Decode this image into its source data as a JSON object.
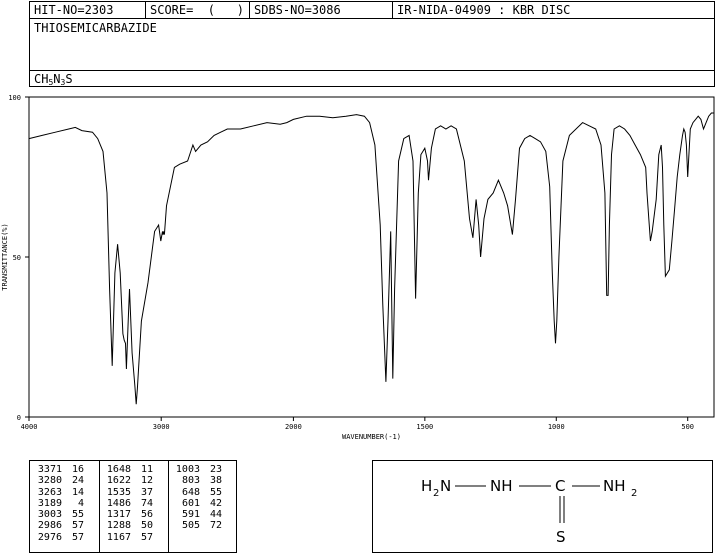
{
  "header": {
    "hit_no": "HIT-NO=2303",
    "score": "SCORE=  (   )",
    "sdbs_no": "SDBS-NO=3086",
    "ir_info": "IR-NIDA-04909 : KBR DISC",
    "compound": "THIOSEMICARBAZIDE",
    "formula": {
      "c": "CH",
      "n1": "5",
      "n": "N",
      "n2": "3",
      "s": "S"
    }
  },
  "chart_data": {
    "type": "line",
    "title": "",
    "xlabel": "WAVENUMBER(-1)",
    "ylabel": "TRANSMITTANCE(%)",
    "xlim": [
      4000,
      400
    ],
    "ylim": [
      0,
      100
    ],
    "x_ticks": [
      4000,
      3000,
      2000,
      1500,
      1000,
      500
    ],
    "x_tick_labels": [
      "4000",
      "3000",
      "2000",
      "1500",
      "1000",
      "500"
    ],
    "y_ticks": [
      0,
      50,
      100
    ],
    "y_tick_labels": [
      "0",
      "50",
      "100"
    ],
    "grid": false,
    "x": [
      4000,
      3900,
      3800,
      3700,
      3650,
      3600,
      3520,
      3480,
      3440,
      3410,
      3390,
      3371,
      3350,
      3330,
      3310,
      3290,
      3280,
      3270,
      3263,
      3250,
      3240,
      3220,
      3200,
      3189,
      3180,
      3150,
      3100,
      3050,
      3020,
      3003,
      2990,
      2986,
      2980,
      2976,
      2960,
      2900,
      2860,
      2800,
      2760,
      2740,
      2700,
      2650,
      2600,
      2550,
      2500,
      2400,
      2300,
      2200,
      2100,
      2050,
      2000,
      1950,
      1900,
      1850,
      1800,
      1760,
      1730,
      1710,
      1690,
      1670,
      1660,
      1648,
      1640,
      1630,
      1622,
      1615,
      1600,
      1580,
      1560,
      1545,
      1535,
      1525,
      1515,
      1500,
      1490,
      1486,
      1475,
      1460,
      1440,
      1420,
      1400,
      1380,
      1350,
      1330,
      1317,
      1305,
      1295,
      1288,
      1275,
      1260,
      1240,
      1220,
      1200,
      1185,
      1167,
      1155,
      1140,
      1120,
      1100,
      1080,
      1060,
      1040,
      1025,
      1015,
      1008,
      1003,
      998,
      990,
      975,
      950,
      900,
      850,
      830,
      815,
      808,
      803,
      798,
      790,
      780,
      760,
      740,
      720,
      700,
      680,
      660,
      655,
      648,
      642,
      635,
      620,
      610,
      601,
      596,
      591,
      585,
      570,
      560,
      550,
      540,
      530,
      520,
      515,
      510,
      505,
      500,
      490,
      480,
      470,
      460,
      450,
      440,
      430,
      420,
      410,
      400
    ],
    "y": [
      87,
      88,
      89,
      90,
      90.5,
      89.5,
      89,
      87,
      83,
      70,
      40,
      16,
      45,
      54,
      45,
      26,
      24,
      23,
      15,
      30,
      40,
      20,
      10,
      4,
      9,
      30,
      42,
      58,
      60,
      55,
      58,
      57,
      58,
      57,
      66,
      78,
      79,
      80,
      85,
      83,
      85,
      86,
      88,
      89,
      90,
      90,
      91,
      92,
      91.5,
      92,
      93,
      94,
      94,
      93.5,
      94,
      94.5,
      94,
      92,
      85,
      60,
      35,
      11,
      30,
      58,
      12,
      40,
      80,
      87,
      88,
      80,
      37,
      70,
      82,
      84,
      80,
      74,
      84,
      90,
      91,
      90,
      91,
      90,
      80,
      62,
      56,
      68,
      60,
      50,
      62,
      68,
      70,
      74,
      70,
      66,
      57,
      68,
      84,
      87,
      88,
      87,
      86,
      83,
      72,
      45,
      30,
      23,
      30,
      50,
      80,
      88,
      92,
      90,
      85,
      70,
      38,
      38,
      60,
      82,
      90,
      91,
      90,
      88,
      85,
      82,
      78,
      70,
      62,
      55,
      58,
      68,
      82,
      85,
      78,
      60,
      44,
      46,
      55,
      65,
      75,
      82,
      88,
      90,
      89,
      85,
      75,
      90,
      92,
      93,
      94,
      93,
      90,
      92,
      94,
      95,
      95,
      95
    ]
  },
  "peak_table": {
    "columns": [
      [
        [
          "3371",
          "16"
        ],
        [
          "3280",
          "24"
        ],
        [
          "3263",
          "14"
        ],
        [
          "3189",
          "4"
        ],
        [
          "3003",
          "55"
        ],
        [
          "2986",
          "57"
        ],
        [
          "2976",
          "57"
        ]
      ],
      [
        [
          "1648",
          "11"
        ],
        [
          "1622",
          "12"
        ],
        [
          "1535",
          "37"
        ],
        [
          "1486",
          "74"
        ],
        [
          "1317",
          "56"
        ],
        [
          "1288",
          "50"
        ],
        [
          "1167",
          "57"
        ]
      ],
      [
        [
          "1003",
          "23"
        ],
        [
          "803",
          "38"
        ],
        [
          "648",
          "55"
        ],
        [
          "601",
          "42"
        ],
        [
          "591",
          "44"
        ],
        [
          "505",
          "72"
        ]
      ]
    ]
  },
  "structure": {
    "h2n_h": "H",
    "h2n_sub": "2",
    "h2n_n": "N",
    "nh": "NH",
    "c": "C",
    "nh2_nh": "NH",
    "nh2_sub": "2",
    "s": "S"
  }
}
